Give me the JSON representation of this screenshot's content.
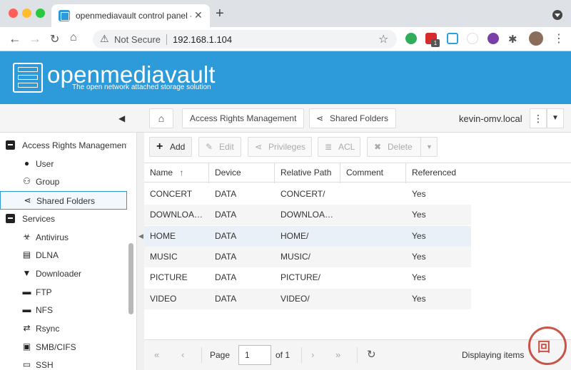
{
  "browser": {
    "tab_title": "openmediavault control panel -",
    "close_glyph": "✕",
    "new_tab_glyph": "+",
    "security_label": "Not Secure",
    "url": "192.168.1.104",
    "extension_badge": "1",
    "colors": {
      "chrome_bg": "#dee1e6",
      "red": "#ff5f57",
      "yellow": "#febc2e",
      "green": "#28c840"
    }
  },
  "app": {
    "brand": "openmediavault",
    "tagline": "The open network attached storage solution",
    "accent": "#2d9ad9"
  },
  "breadcrumb": {
    "home_icon": "home-icon",
    "items": [
      "Access Rights Management",
      "Shared Folders"
    ],
    "host": "kevin-omv.local"
  },
  "sidebar": {
    "items": [
      {
        "label": "Access Rights Management",
        "icon": "minus-square-icon",
        "level": 0
      },
      {
        "label": "User",
        "icon": "user-icon",
        "level": 1
      },
      {
        "label": "Group",
        "icon": "group-icon",
        "level": 1
      },
      {
        "label": "Shared Folders",
        "icon": "share-icon",
        "level": 1,
        "selected": true
      },
      {
        "label": "Services",
        "icon": "minus-square-icon",
        "level": 0
      },
      {
        "label": "Antivirus",
        "icon": "biohazard-icon",
        "level": 1
      },
      {
        "label": "DLNA",
        "icon": "film-icon",
        "level": 1
      },
      {
        "label": "Downloader",
        "icon": "download-icon",
        "level": 1
      },
      {
        "label": "FTP",
        "icon": "ftp-icon",
        "level": 1
      },
      {
        "label": "NFS",
        "icon": "nfs-icon",
        "level": 1
      },
      {
        "label": "Rsync",
        "icon": "rsync-icon",
        "level": 1
      },
      {
        "label": "SMB/CIFS",
        "icon": "smb-icon",
        "level": 1
      },
      {
        "label": "SSH",
        "icon": "terminal-icon",
        "level": 1
      }
    ]
  },
  "actions": {
    "add": "Add",
    "edit": "Edit",
    "privileges": "Privileges",
    "acl": "ACL",
    "delete": "Delete"
  },
  "table": {
    "columns": [
      "Name",
      "Device",
      "Relative Path",
      "Comment",
      "Referenced"
    ],
    "sort_indicator": "↑",
    "rows": [
      [
        "CONCERT",
        "DATA",
        "CONCERT/",
        "",
        "Yes"
      ],
      [
        "DOWNLOA…",
        "DATA",
        "DOWNLOA…",
        "",
        "Yes"
      ],
      [
        "HOME",
        "DATA",
        "HOME/",
        "",
        "Yes"
      ],
      [
        "MUSIC",
        "DATA",
        "MUSIC/",
        "",
        "Yes"
      ],
      [
        "PICTURE",
        "DATA",
        "PICTURE/",
        "",
        "Yes"
      ],
      [
        "VIDEO",
        "DATA",
        "VIDEO/",
        "",
        "Yes"
      ]
    ]
  },
  "pager": {
    "page_label": "Page",
    "page_value": "1",
    "of_label": "of 1",
    "status": "Displaying items"
  },
  "seal_text": "回"
}
